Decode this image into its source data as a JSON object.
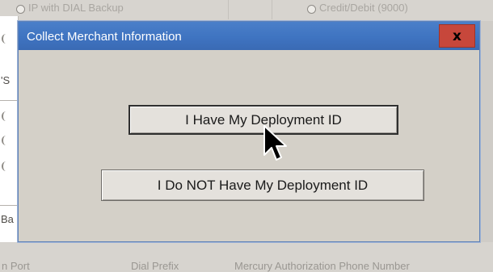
{
  "background_form": {
    "top_options": [
      "IP with DIAL Backup",
      "Credit/Debit (9000)"
    ],
    "left_fragments": [
      "'S",
      "Ba"
    ],
    "bottom_labels": [
      "n Port",
      "Dial Prefix",
      "Mercury Authorization Phone Number"
    ]
  },
  "dialog": {
    "title": "Collect Merchant Information",
    "close_label": "x",
    "buttons": {
      "have_id": "I Have My Deployment ID",
      "no_id": "I Do NOT Have My Deployment ID"
    }
  },
  "colors": {
    "titlebar": "#3f74c1",
    "close_button": "#c7473b",
    "dialog_face": "#d4d0c8"
  },
  "icons": {
    "close": "close-icon",
    "pointer": "mouse-pointer-icon"
  }
}
